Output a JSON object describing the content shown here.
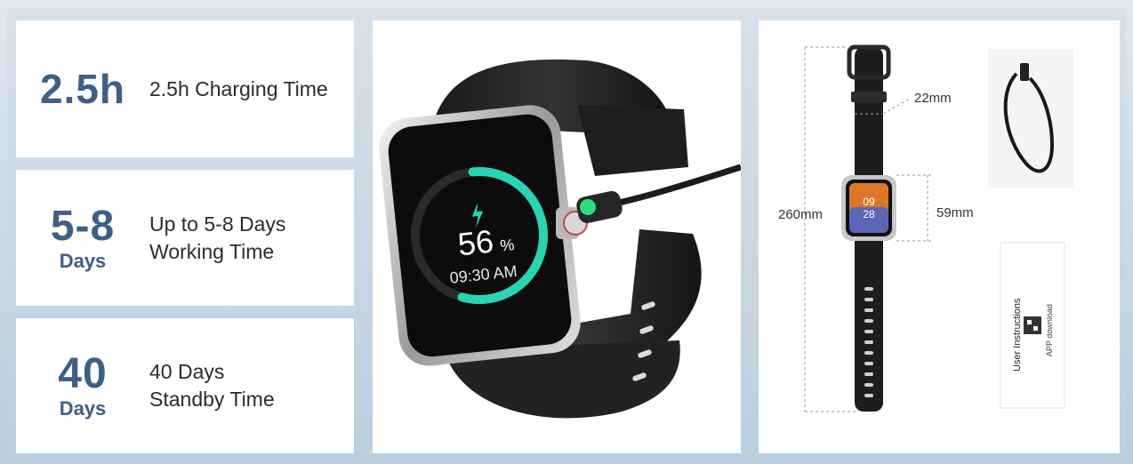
{
  "stats": [
    {
      "value": "2.5h",
      "unit": "",
      "description": "2.5h Charging Time"
    },
    {
      "value": "5-8",
      "unit": "Days",
      "description": "Up to 5-8 Days\nWorking Time"
    },
    {
      "value": "40",
      "unit": "Days",
      "description": "40 Days\nStandby Time"
    }
  ],
  "watch_screen": {
    "battery_percent": "56",
    "percent_sign": "%",
    "time": "09:30 AM",
    "charge_level": 0.56
  },
  "dimensions": {
    "strap_width": "22mm",
    "total_length": "260mm",
    "case_height": "59mm"
  },
  "small_watch_screen": {
    "hour": "09",
    "minute": "28"
  },
  "manual": {
    "title": "User Instructions",
    "subtitle": "APP download"
  },
  "colors": {
    "accent": "#3f5f86",
    "ring": "#28d4b4"
  }
}
